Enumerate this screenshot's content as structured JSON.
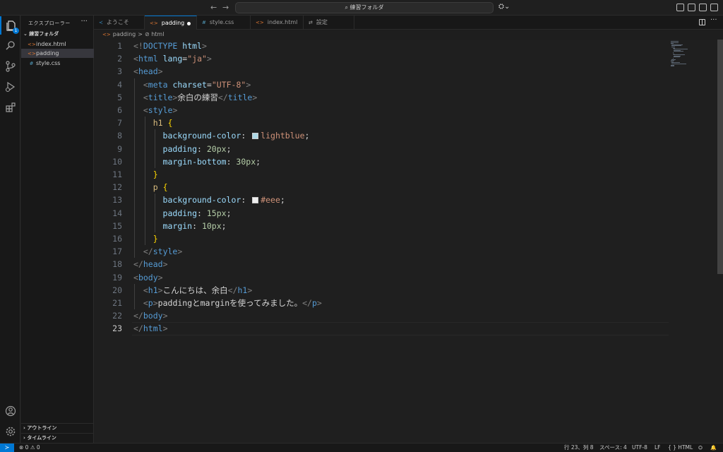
{
  "titlebar": {
    "back_arrow": "←",
    "forward_arrow": "→",
    "search_label": "⌕ 練習フォルダ",
    "copilot_label": "⛭⌄"
  },
  "activity_bar": {
    "explorer_badge": "1"
  },
  "sidebar": {
    "title": "エクスプローラー",
    "more": "···",
    "folder_label": "⌄ 練習フォルダ",
    "files": [
      {
        "icon": "<>",
        "name": "index.html"
      },
      {
        "icon": "<>",
        "name": "padding"
      },
      {
        "icon": "#",
        "name": "style.css"
      }
    ],
    "outline_label": "› アウトライン",
    "timeline_label": "› タイムライン"
  },
  "tabs": [
    {
      "icon": "≺",
      "label": "ようこそ"
    },
    {
      "icon": "<>",
      "label": "padding"
    },
    {
      "icon": "#",
      "label": "style.css"
    },
    {
      "icon": "<>",
      "label": "index.html"
    },
    {
      "icon": "⇄",
      "label": "設定"
    }
  ],
  "breadcrumb": {
    "file": "padding",
    "separator": ">",
    "symbol": "⊘ html"
  },
  "editor": {
    "current_line": 23,
    "lines": [
      [
        [
          "t-br",
          "<!"
        ],
        [
          "t-tag",
          "DOCTYPE"
        ],
        [
          "t-txt",
          " "
        ],
        [
          "t-attr",
          "html"
        ],
        [
          "t-br",
          ">"
        ]
      ],
      [
        [
          "t-br",
          "<"
        ],
        [
          "t-tag",
          "html"
        ],
        [
          "t-txt",
          " "
        ],
        [
          "t-attr",
          "lang"
        ],
        [
          "t-txt",
          "="
        ],
        [
          "t-str",
          "\"ja\""
        ],
        [
          "t-br",
          ">"
        ]
      ],
      [
        [
          "t-br",
          "<"
        ],
        [
          "t-tag",
          "head"
        ],
        [
          "t-br",
          ">"
        ]
      ],
      [
        [
          "t-txt",
          "  "
        ],
        [
          "t-br",
          "<"
        ],
        [
          "t-tag",
          "meta"
        ],
        [
          "t-txt",
          " "
        ],
        [
          "t-attr",
          "charset"
        ],
        [
          "t-txt",
          "="
        ],
        [
          "t-str",
          "\"UTF-8\""
        ],
        [
          "t-br",
          ">"
        ]
      ],
      [
        [
          "t-txt",
          "  "
        ],
        [
          "t-br",
          "<"
        ],
        [
          "t-tag",
          "title"
        ],
        [
          "t-br",
          ">"
        ],
        [
          "t-txt",
          "余白の練習"
        ],
        [
          "t-br",
          "</"
        ],
        [
          "t-tag",
          "title"
        ],
        [
          "t-br",
          ">"
        ]
      ],
      [
        [
          "t-txt",
          "  "
        ],
        [
          "t-br",
          "<"
        ],
        [
          "t-tag",
          "style"
        ],
        [
          "t-br",
          ">"
        ]
      ],
      [
        [
          "t-txt",
          "    "
        ],
        [
          "t-sel",
          "h1"
        ],
        [
          "t-txt",
          " "
        ],
        [
          "t-brace",
          "{"
        ]
      ],
      [
        [
          "t-txt",
          "      "
        ],
        [
          "t-prop",
          "background-color"
        ],
        [
          "t-txt",
          ": "
        ],
        [
          "swatch",
          "#add8e6"
        ],
        [
          "t-val",
          "lightblue"
        ],
        [
          "t-txt",
          ";"
        ]
      ],
      [
        [
          "t-txt",
          "      "
        ],
        [
          "t-prop",
          "padding"
        ],
        [
          "t-txt",
          ": "
        ],
        [
          "t-num",
          "20px"
        ],
        [
          "t-txt",
          ";"
        ]
      ],
      [
        [
          "t-txt",
          "      "
        ],
        [
          "t-prop",
          "margin-bottom"
        ],
        [
          "t-txt",
          ": "
        ],
        [
          "t-num",
          "30px"
        ],
        [
          "t-txt",
          ";"
        ]
      ],
      [
        [
          "t-txt",
          "    "
        ],
        [
          "t-brace",
          "}"
        ]
      ],
      [
        [
          "t-txt",
          "    "
        ],
        [
          "t-sel",
          "p"
        ],
        [
          "t-txt",
          " "
        ],
        [
          "t-brace",
          "{"
        ]
      ],
      [
        [
          "t-txt",
          "      "
        ],
        [
          "t-prop",
          "background-color"
        ],
        [
          "t-txt",
          ": "
        ],
        [
          "swatch",
          "#eeeeee"
        ],
        [
          "t-val",
          "#eee"
        ],
        [
          "t-txt",
          ";"
        ]
      ],
      [
        [
          "t-txt",
          "      "
        ],
        [
          "t-prop",
          "padding"
        ],
        [
          "t-txt",
          ": "
        ],
        [
          "t-num",
          "15px"
        ],
        [
          "t-txt",
          ";"
        ]
      ],
      [
        [
          "t-txt",
          "      "
        ],
        [
          "t-prop",
          "margin"
        ],
        [
          "t-txt",
          ": "
        ],
        [
          "t-num",
          "10px"
        ],
        [
          "t-txt",
          ";"
        ]
      ],
      [
        [
          "t-txt",
          "    "
        ],
        [
          "t-brace",
          "}"
        ]
      ],
      [
        [
          "t-txt",
          "  "
        ],
        [
          "t-br",
          "</"
        ],
        [
          "t-tag",
          "style"
        ],
        [
          "t-br",
          ">"
        ]
      ],
      [
        [
          "t-br",
          "</"
        ],
        [
          "t-tag",
          "head"
        ],
        [
          "t-br",
          ">"
        ]
      ],
      [
        [
          "t-br",
          "<"
        ],
        [
          "t-tag",
          "body"
        ],
        [
          "t-br",
          ">"
        ]
      ],
      [
        [
          "t-txt",
          "  "
        ],
        [
          "t-br",
          "<"
        ],
        [
          "t-tag",
          "h1"
        ],
        [
          "t-br",
          ">"
        ],
        [
          "t-txt",
          "こんにちは、余白"
        ],
        [
          "t-br",
          "</"
        ],
        [
          "t-tag",
          "h1"
        ],
        [
          "t-br",
          ">"
        ]
      ],
      [
        [
          "t-txt",
          "  "
        ],
        [
          "t-br",
          "<"
        ],
        [
          "t-tag",
          "p"
        ],
        [
          "t-br",
          ">"
        ],
        [
          "t-txt",
          "paddingとmarginを使ってみました。"
        ],
        [
          "t-br",
          "</"
        ],
        [
          "t-tag",
          "p"
        ],
        [
          "t-br",
          ">"
        ]
      ],
      [
        [
          "t-br",
          "</"
        ],
        [
          "t-tag",
          "body"
        ],
        [
          "t-br",
          ">"
        ]
      ],
      [
        [
          "t-br",
          "</"
        ],
        [
          "t-tag",
          "html"
        ],
        [
          "t-br",
          ">"
        ]
      ]
    ]
  },
  "statusbar": {
    "remote_icon": "≻",
    "problems": "⊗ 0 ⚠ 0",
    "position": "行 23、列 8",
    "spaces": "スペース: 4",
    "encoding": "UTF-8",
    "eol": "LF",
    "language": "{ } HTML",
    "copilot_icon": "⛭",
    "bell_icon": "🔔"
  },
  "colors": {
    "accent": "#0078d4",
    "editor_bg": "#1f1f1f",
    "sidebar_bg": "#181818"
  }
}
